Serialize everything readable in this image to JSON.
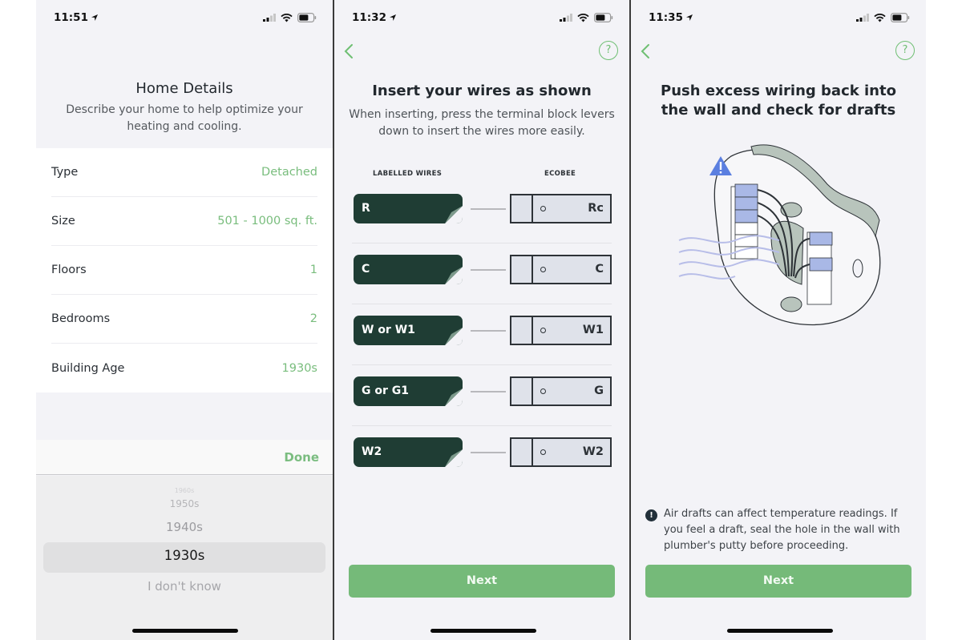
{
  "screens": [
    {
      "status": {
        "time": "11:51"
      },
      "title": "Home Details",
      "subtitle": "Describe your home to help optimize your heating and cooling.",
      "fields": [
        {
          "label": "Type",
          "value": "Detached"
        },
        {
          "label": "Size",
          "value": "501 - 1000 sq. ft."
        },
        {
          "label": "Floors",
          "value": "1"
        },
        {
          "label": "Bedrooms",
          "value": "2"
        },
        {
          "label": "Building Age",
          "value": "1930s"
        }
      ],
      "picker": {
        "done_label": "Done",
        "options": [
          "1960s",
          "1950s",
          "1940s",
          "1930s",
          "I don't know"
        ],
        "selected": "1930s"
      }
    },
    {
      "status": {
        "time": "11:32"
      },
      "title": "Insert your wires as shown",
      "subtitle": "When inserting, press the terminal block levers down to insert the wires more easily.",
      "col_left": "LABELLED WIRES",
      "col_right": "ECOBEE",
      "wires": [
        {
          "label": "R",
          "terminal": "Rc"
        },
        {
          "label": "C",
          "terminal": "C"
        },
        {
          "label": "W or W1",
          "terminal": "W1"
        },
        {
          "label": "G or G1",
          "terminal": "G"
        },
        {
          "label": "W2",
          "terminal": "W2"
        }
      ],
      "next_label": "Next"
    },
    {
      "status": {
        "time": "11:35"
      },
      "title": "Push excess wiring back into the wall and check for drafts",
      "note": "Air drafts can affect temperature readings. If you feel a draft, seal the hole in the wall with plumber's putty before proceeding.",
      "next_label": "Next"
    }
  ],
  "icons": {
    "help": "?",
    "info": "!"
  },
  "colors": {
    "accent_green": "#75ba79",
    "wire_tag": "#1f3d34",
    "warning_blue": "#5b7fe0"
  }
}
